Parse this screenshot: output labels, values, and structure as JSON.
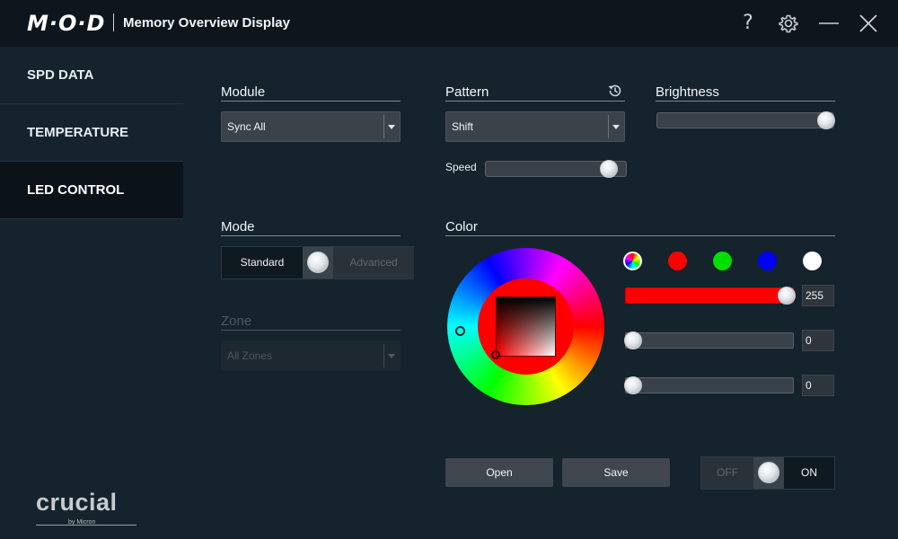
{
  "app": {
    "logo": "M·O·D",
    "title": "Memory Overview Display",
    "help_glyph": "?",
    "window_icons": [
      "help-icon",
      "gear-icon",
      "minimize-icon",
      "close-icon"
    ]
  },
  "sidebar": {
    "items": [
      {
        "label": "SPD DATA",
        "active": false
      },
      {
        "label": "TEMPERATURE",
        "active": false
      },
      {
        "label": "LED CONTROL",
        "active": true
      }
    ],
    "brand": {
      "name": "crucial",
      "byline": "by Micron"
    }
  },
  "module": {
    "label": "Module",
    "selected": "Sync All"
  },
  "pattern": {
    "label": "Pattern",
    "selected": "Shift",
    "speed_label": "Speed",
    "speed_level": 1.0,
    "reset_icon": "history-icon"
  },
  "brightness": {
    "label": "Brightness",
    "level": 1.0
  },
  "mode": {
    "label": "Mode",
    "standard": "Standard",
    "advanced": "Advanced",
    "selected": "Standard"
  },
  "zone": {
    "label": "Zone",
    "selected": "All Zones",
    "enabled": false
  },
  "color": {
    "label": "Color",
    "swatches": [
      {
        "name": "rainbow",
        "color": "rainbow"
      },
      {
        "name": "red",
        "color": "#ff0000"
      },
      {
        "name": "green",
        "color": "#00e000"
      },
      {
        "name": "blue",
        "color": "#0000ff"
      },
      {
        "name": "white",
        "color": "#ffffff"
      }
    ],
    "channels": [
      {
        "name": "red",
        "value": "255",
        "level": 1.0
      },
      {
        "name": "green",
        "value": "0",
        "level": 0.0
      },
      {
        "name": "blue",
        "value": "0",
        "level": 0.0
      }
    ]
  },
  "actions": {
    "open": "Open",
    "save": "Save"
  },
  "power": {
    "off": "OFF",
    "on": "ON",
    "state": "ON"
  }
}
